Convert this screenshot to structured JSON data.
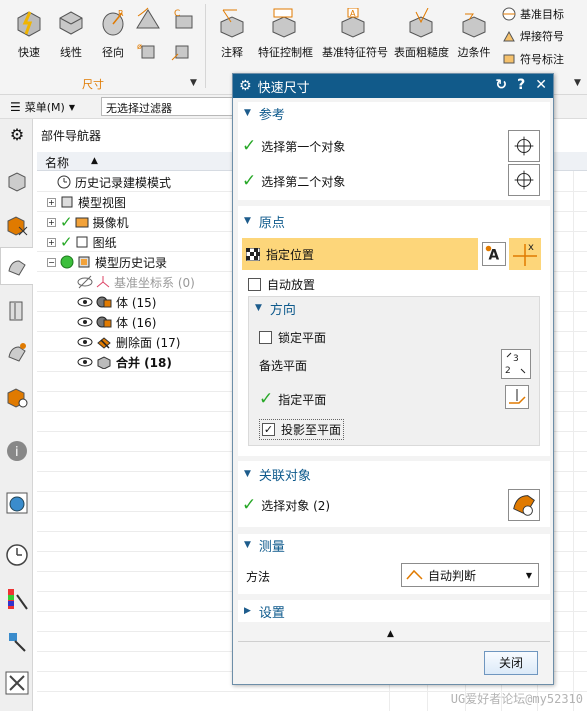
{
  "ribbon": {
    "buttons": [
      "快速",
      "线性",
      "径向"
    ],
    "group_label": "尺寸",
    "right_buttons": [
      "注释",
      "特征控制框",
      "基准特征符号",
      "表面粗糙度",
      "边条件"
    ],
    "small_items": [
      "基准目标",
      "焊接符号",
      "符号标注"
    ]
  },
  "toolbar": {
    "menu_label": "菜单(M)",
    "filter_value": "无选择过滤器"
  },
  "navigator": {
    "title": "部件导航器",
    "column_name": "名称",
    "rows": [
      {
        "label": "历史记录建模模式"
      },
      {
        "label": "模型视图"
      },
      {
        "label": "摄像机"
      },
      {
        "label": "图纸"
      },
      {
        "label": "模型历史记录"
      },
      {
        "label": "基准坐标系 (0)"
      },
      {
        "label": "体 (15)"
      },
      {
        "label": "体 (16)"
      },
      {
        "label": "删除面 (17)"
      },
      {
        "label": "合并 (18)"
      }
    ]
  },
  "dialog": {
    "title": "快速尺寸",
    "sections": {
      "reference": "参考",
      "origin": "原点",
      "direction": "方向",
      "associated": "关联对象",
      "measure": "测量",
      "settings": "设置"
    },
    "select_first": "选择第一个对象",
    "select_second": "选择第二个对象",
    "specify_location": "指定位置",
    "auto_place": "自动放置",
    "lock_plane": "锁定平面",
    "alt_plane": "备选平面",
    "specify_plane": "指定平面",
    "project_to_plane": "投影至平面",
    "select_objects": "选择对象 (2)",
    "method_label": "方法",
    "method_value": "自动判断",
    "close_label": "关闭"
  },
  "watermark": "UG爱好者论坛@my52310"
}
